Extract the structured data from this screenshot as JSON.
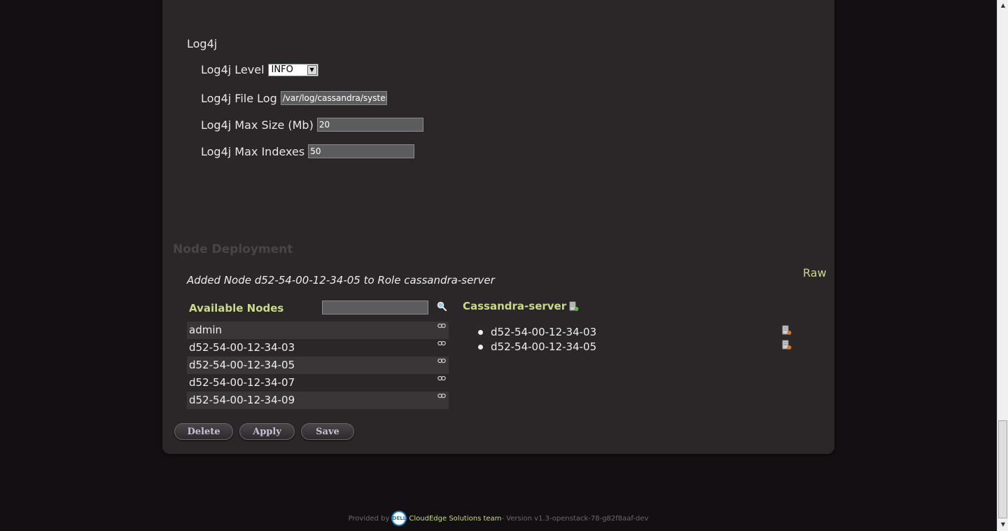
{
  "log4j": {
    "title": "Log4j",
    "level_label": "Log4j Level",
    "level_value": "INFO",
    "file_log_label": "Log4j File Log",
    "file_log_value": "/var/log/cassandra/system",
    "max_size_label": "Log4j Max Size (Mb)",
    "max_size_value": "20",
    "max_indexes_label": "Log4j Max Indexes",
    "max_indexes_value": "50"
  },
  "node_deployment": {
    "title": "Node Deployment",
    "raw_link": "Raw",
    "status_message": "Added Node d52-54-00-12-34-05 to Role cassandra-server",
    "available_title": "Available Nodes",
    "available_nodes": [
      "admin",
      "d52-54-00-12-34-03",
      "d52-54-00-12-34-05",
      "d52-54-00-12-34-07",
      "d52-54-00-12-34-09"
    ],
    "role_title": "Cassandra-server",
    "role_nodes": [
      "d52-54-00-12-34-03",
      "d52-54-00-12-34-05"
    ]
  },
  "buttons": {
    "delete": "Delete",
    "apply": "Apply",
    "save": "Save"
  },
  "footer": {
    "provided_by": "Provided by",
    "logo_text": "DELL",
    "team": "CloudEdge Solutions team",
    "version": " - Version v1.3-openstack-78-g82f8aaf-dev"
  },
  "icons": {
    "search": "search-icon",
    "link": "link-icon",
    "add_server": "server-add-icon",
    "remove_server": "server-remove-icon"
  },
  "colors": {
    "background": "#140f12",
    "panel": "#2b2628",
    "accent": "#c9d98a"
  }
}
